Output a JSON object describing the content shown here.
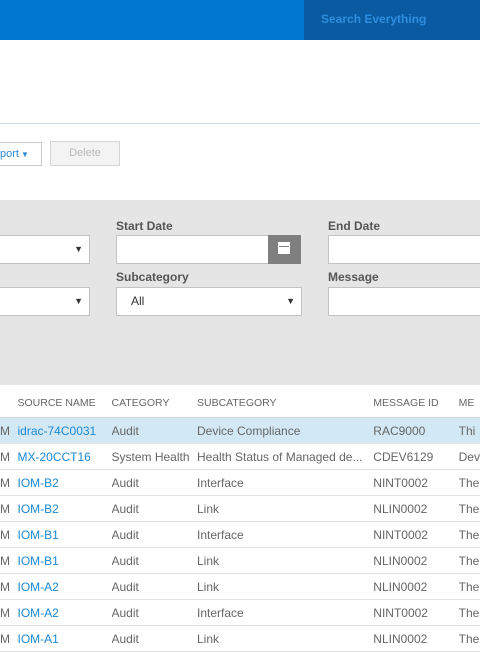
{
  "header": {
    "search_label": "Search Everything"
  },
  "toolbar": {
    "export_label": "port",
    "delete_label": "Delete"
  },
  "filters": {
    "start_date_label": "Start Date",
    "end_date_label": "End Date",
    "subcategory_label": "Subcategory",
    "subcategory_value": "All",
    "message_label": "Message"
  },
  "table": {
    "headers": [
      "",
      "SOURCE NAME",
      "CATEGORY",
      "SUBCATEGORY",
      "MESSAGE ID",
      "ME"
    ],
    "rows": [
      [
        "M",
        "idrac-74C0031",
        "Audit",
        "Device Compliance",
        "RAC9000",
        "Thi"
      ],
      [
        "M",
        "MX-20CCT16",
        "System Health",
        "Health Status of Managed de...",
        "CDEV6129",
        "Dev"
      ],
      [
        "M",
        "IOM-B2",
        "Audit",
        "Interface",
        "NINT0002",
        "The"
      ],
      [
        "M",
        "IOM-B2",
        "Audit",
        "Link",
        "NLIN0002",
        "The"
      ],
      [
        "M",
        "IOM-B1",
        "Audit",
        "Interface",
        "NINT0002",
        "The"
      ],
      [
        "M",
        "IOM-B1",
        "Audit",
        "Link",
        "NLIN0002",
        "The"
      ],
      [
        "M",
        "IOM-A2",
        "Audit",
        "Link",
        "NLIN0002",
        "The"
      ],
      [
        "M",
        "IOM-A2",
        "Audit",
        "Interface",
        "NINT0002",
        "The"
      ],
      [
        "M",
        "IOM-A1",
        "Audit",
        "Link",
        "NLIN0002",
        "The"
      ]
    ]
  },
  "colors": {
    "brand": "#0076ce",
    "search_bg": "#0a5aa1",
    "link": "#1a88d3",
    "selected_row": "#d3e8f5",
    "filter_bg": "#e5e5e5"
  }
}
